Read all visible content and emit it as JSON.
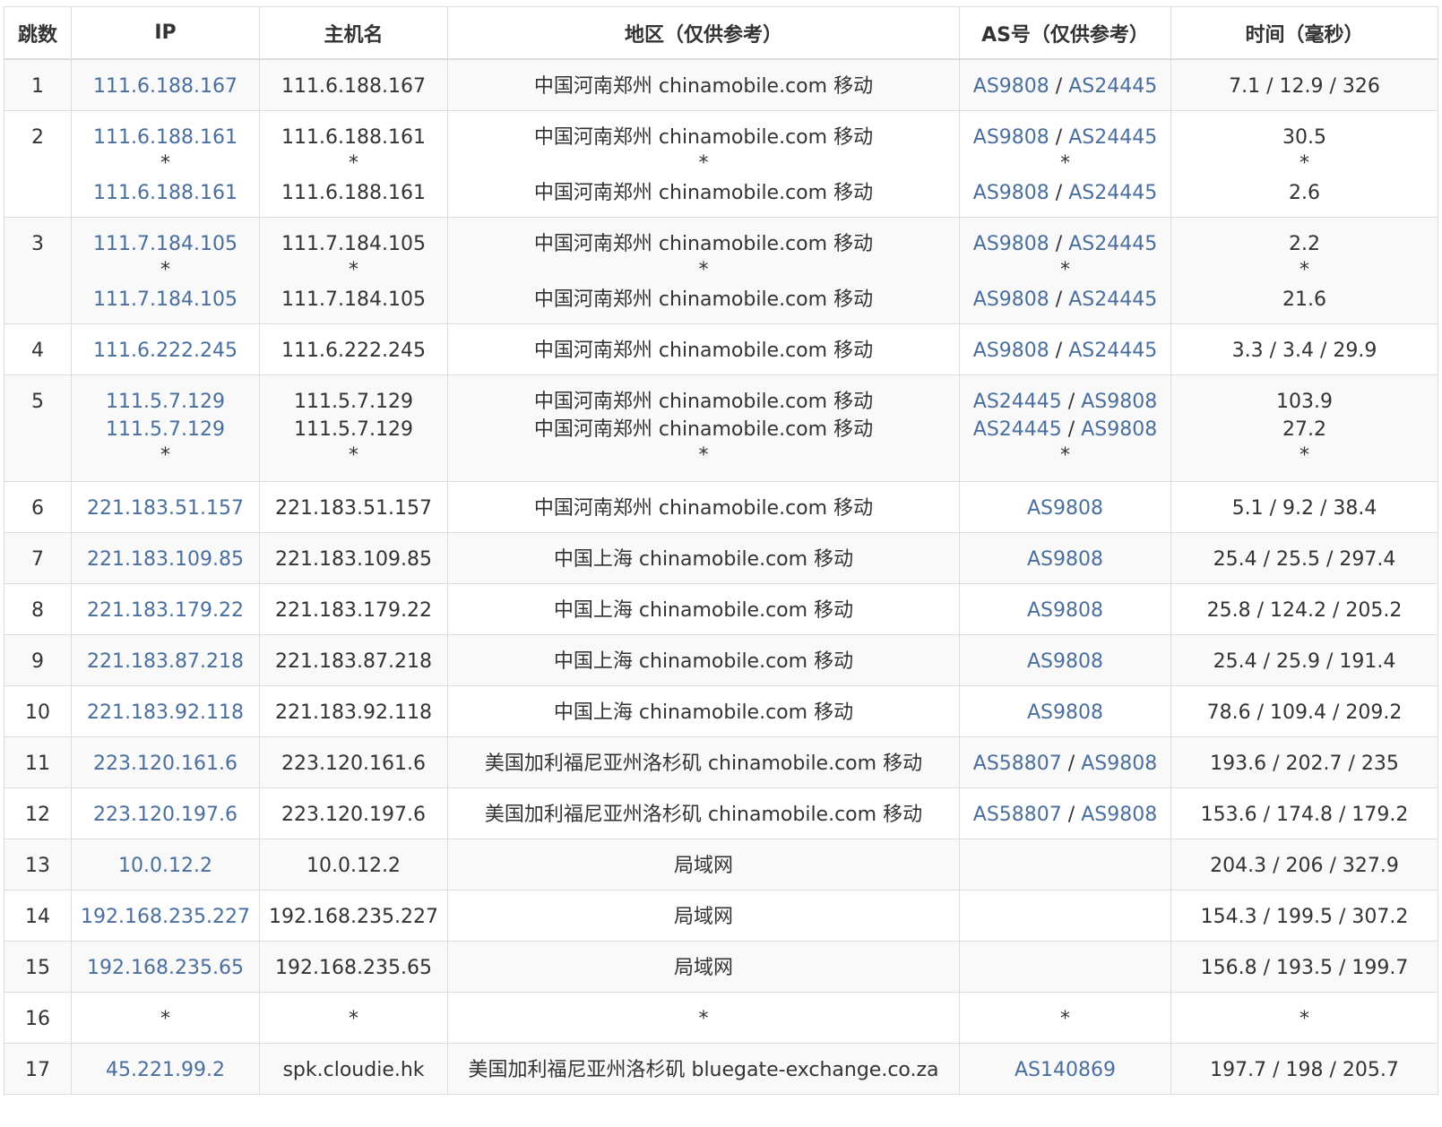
{
  "headers": [
    "跳数",
    "IP",
    "主机名",
    "地区（仅供参考）",
    "AS号（仅供参考）",
    "时间（毫秒）"
  ],
  "rows": [
    {
      "hop": "1",
      "lines": [
        {
          "ip": "111.6.188.167",
          "host": "111.6.188.167",
          "region": "中国河南郑州 chinamobile.com 移动",
          "as": [
            "AS9808",
            "AS24445"
          ],
          "time": "7.1 / 12.9 / 326"
        }
      ]
    },
    {
      "hop": "2",
      "lines": [
        {
          "ip": "111.6.188.161",
          "host": "111.6.188.161",
          "region": "中国河南郑州 chinamobile.com 移动",
          "as": [
            "AS9808",
            "AS24445"
          ],
          "time": "30.5"
        },
        {
          "ip": "*",
          "host": "*",
          "region": "*",
          "as": [
            "*"
          ],
          "time": "*"
        },
        {
          "ip": "111.6.188.161",
          "host": "111.6.188.161",
          "region": "中国河南郑州 chinamobile.com 移动",
          "as": [
            "AS9808",
            "AS24445"
          ],
          "time": "2.6"
        }
      ]
    },
    {
      "hop": "3",
      "lines": [
        {
          "ip": "111.7.184.105",
          "host": "111.7.184.105",
          "region": "中国河南郑州 chinamobile.com 移动",
          "as": [
            "AS9808",
            "AS24445"
          ],
          "time": "2.2"
        },
        {
          "ip": "*",
          "host": "*",
          "region": "*",
          "as": [
            "*"
          ],
          "time": "*"
        },
        {
          "ip": "111.7.184.105",
          "host": "111.7.184.105",
          "region": "中国河南郑州 chinamobile.com 移动",
          "as": [
            "AS9808",
            "AS24445"
          ],
          "time": "21.6"
        }
      ]
    },
    {
      "hop": "4",
      "lines": [
        {
          "ip": "111.6.222.245",
          "host": "111.6.222.245",
          "region": "中国河南郑州 chinamobile.com 移动",
          "as": [
            "AS9808",
            "AS24445"
          ],
          "time": "3.3 / 3.4 / 29.9"
        }
      ]
    },
    {
      "hop": "5",
      "lines": [
        {
          "ip": "111.5.7.129",
          "host": "111.5.7.129",
          "region": "中国河南郑州 chinamobile.com 移动",
          "as": [
            "AS24445",
            "AS9808"
          ],
          "time": "103.9"
        },
        {
          "ip": "111.5.7.129",
          "host": "111.5.7.129",
          "region": "中国河南郑州 chinamobile.com 移动",
          "as": [
            "AS24445",
            "AS9808"
          ],
          "time": "27.2"
        },
        {
          "ip": "*",
          "host": "*",
          "region": "*",
          "as": [
            "*"
          ],
          "time": "*"
        }
      ]
    },
    {
      "hop": "6",
      "lines": [
        {
          "ip": "221.183.51.157",
          "host": "221.183.51.157",
          "region": "中国河南郑州 chinamobile.com 移动",
          "as": [
            "AS9808"
          ],
          "time": "5.1 / 9.2 / 38.4"
        }
      ]
    },
    {
      "hop": "7",
      "lines": [
        {
          "ip": "221.183.109.85",
          "host": "221.183.109.85",
          "region": "中国上海 chinamobile.com 移动",
          "as": [
            "AS9808"
          ],
          "time": "25.4 / 25.5 / 297.4"
        }
      ]
    },
    {
      "hop": "8",
      "lines": [
        {
          "ip": "221.183.179.22",
          "host": "221.183.179.22",
          "region": "中国上海 chinamobile.com 移动",
          "as": [
            "AS9808"
          ],
          "time": "25.8 / 124.2 / 205.2"
        }
      ]
    },
    {
      "hop": "9",
      "lines": [
        {
          "ip": "221.183.87.218",
          "host": "221.183.87.218",
          "region": "中国上海 chinamobile.com 移动",
          "as": [
            "AS9808"
          ],
          "time": "25.4 / 25.9 / 191.4"
        }
      ]
    },
    {
      "hop": "10",
      "lines": [
        {
          "ip": "221.183.92.118",
          "host": "221.183.92.118",
          "region": "中国上海 chinamobile.com 移动",
          "as": [
            "AS9808"
          ],
          "time": "78.6 / 109.4 / 209.2"
        }
      ]
    },
    {
      "hop": "11",
      "lines": [
        {
          "ip": "223.120.161.6",
          "host": "223.120.161.6",
          "region": "美国加利福尼亚州洛杉矶 chinamobile.com 移动",
          "as": [
            "AS58807",
            "AS9808"
          ],
          "time": "193.6 / 202.7 / 235"
        }
      ]
    },
    {
      "hop": "12",
      "lines": [
        {
          "ip": "223.120.197.6",
          "host": "223.120.197.6",
          "region": "美国加利福尼亚州洛杉矶 chinamobile.com 移动",
          "as": [
            "AS58807",
            "AS9808"
          ],
          "time": "153.6 / 174.8 / 179.2"
        }
      ]
    },
    {
      "hop": "13",
      "lines": [
        {
          "ip": "10.0.12.2",
          "host": "10.0.12.2",
          "region": "局域网",
          "as": [],
          "time": "204.3 / 206 / 327.9"
        }
      ]
    },
    {
      "hop": "14",
      "lines": [
        {
          "ip": "192.168.235.227",
          "host": "192.168.235.227",
          "region": "局域网",
          "as": [],
          "time": "154.3 / 199.5 / 307.2"
        }
      ]
    },
    {
      "hop": "15",
      "lines": [
        {
          "ip": "192.168.235.65",
          "host": "192.168.235.65",
          "region": "局域网",
          "as": [],
          "time": "156.8 / 193.5 / 199.7"
        }
      ]
    },
    {
      "hop": "16",
      "lines": [
        {
          "ip": "*",
          "host": "*",
          "region": "*",
          "as": [
            "*"
          ],
          "time": "*"
        }
      ]
    },
    {
      "hop": "17",
      "lines": [
        {
          "ip": "45.221.99.2",
          "host": "spk.cloudie.hk",
          "region": "美国加利福尼亚州洛杉矶 bluegate-exchange.co.za",
          "as": [
            "AS140869"
          ],
          "time": "197.7 / 198 / 205.7"
        }
      ]
    }
  ],
  "colors": {
    "link": "#4a6f9e",
    "text": "#333333",
    "border": "#dddddd",
    "stripe": "#f9f9f9"
  }
}
